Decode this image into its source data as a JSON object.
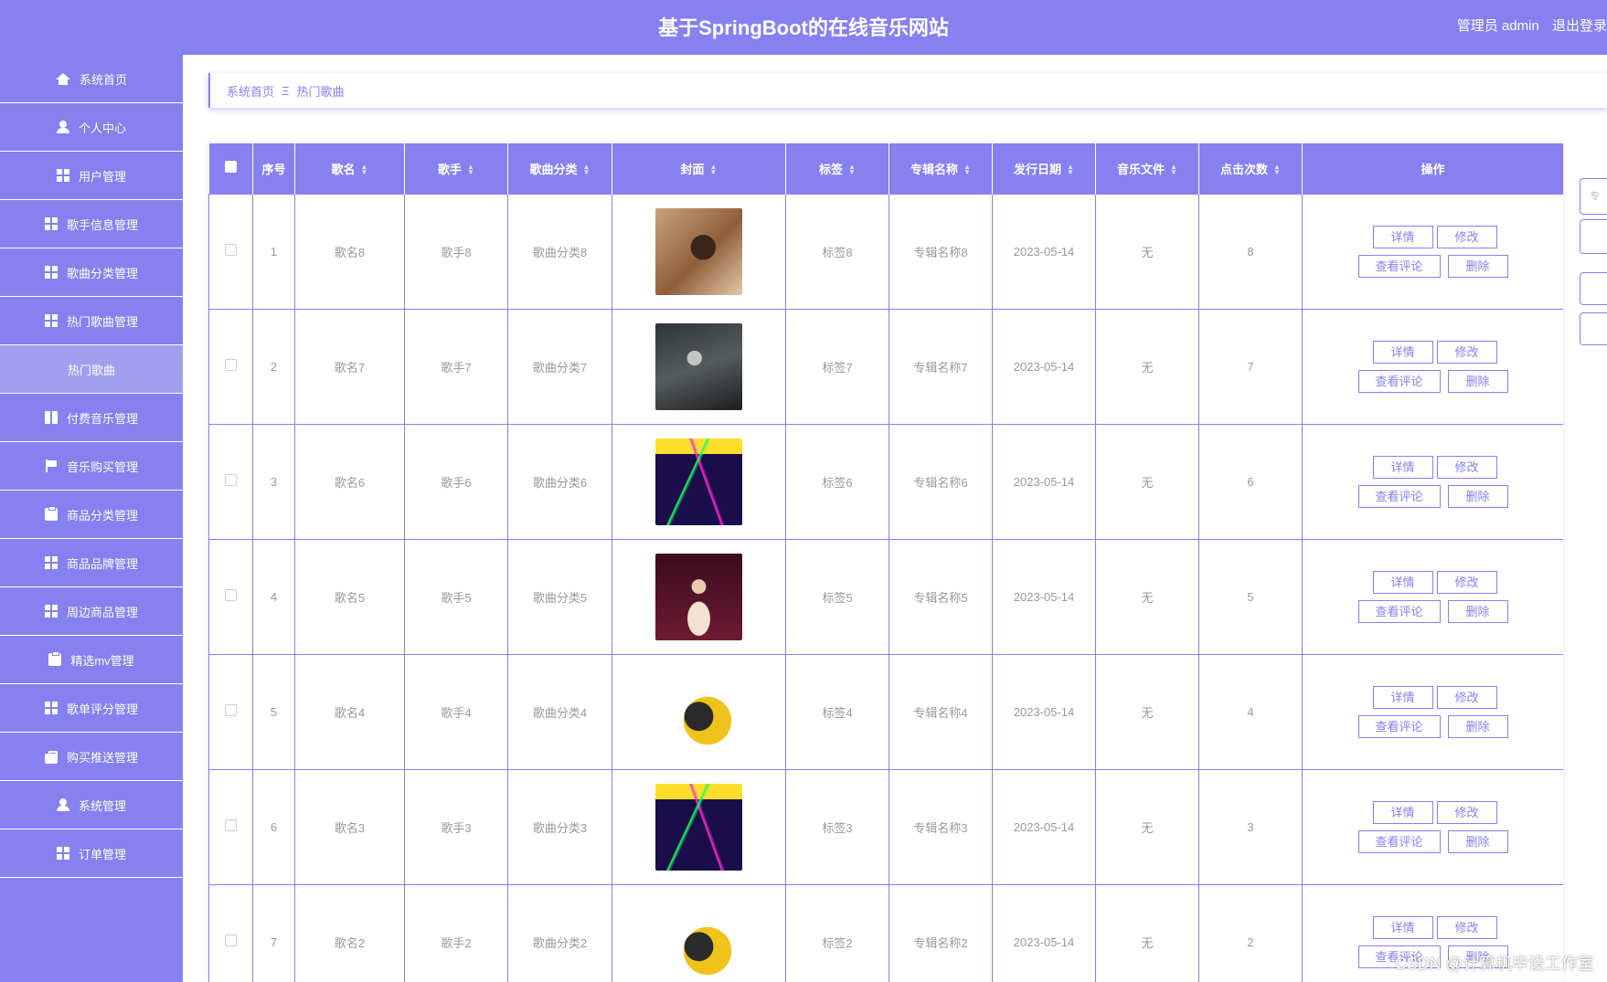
{
  "header": {
    "title": "基于SpringBoot的在线音乐网站",
    "user_label": "管理员 admin",
    "logout": "退出登录"
  },
  "sidebar": {
    "items": [
      {
        "label": "系统首页",
        "icon": "home-icon"
      },
      {
        "label": "个人中心",
        "icon": "user-icon"
      },
      {
        "label": "用户管理",
        "icon": "grid-icon"
      },
      {
        "label": "歌手信息管理",
        "icon": "grid-icon"
      },
      {
        "label": "歌曲分类管理",
        "icon": "grid-icon"
      },
      {
        "label": "热门歌曲管理",
        "icon": "grid-icon"
      },
      {
        "label": "热门歌曲",
        "icon": ""
      },
      {
        "label": "付费音乐管理",
        "icon": "book-icon"
      },
      {
        "label": "音乐购买管理",
        "icon": "flag-icon"
      },
      {
        "label": "商品分类管理",
        "icon": "clipboard-icon"
      },
      {
        "label": "商品品牌管理",
        "icon": "grid-icon"
      },
      {
        "label": "周边商品管理",
        "icon": "grid-icon"
      },
      {
        "label": "精选mv管理",
        "icon": "clipboard-icon"
      },
      {
        "label": "歌单评分管理",
        "icon": "grid-icon"
      },
      {
        "label": "购买推送管理",
        "icon": "briefcase-icon"
      },
      {
        "label": "系统管理",
        "icon": "user-icon"
      },
      {
        "label": "订单管理",
        "icon": "grid-icon"
      }
    ]
  },
  "breadcrumb": {
    "home": "系统首页",
    "separator": "Ξ",
    "current": "热门歌曲"
  },
  "table": {
    "columns": [
      "序号",
      "歌名",
      "歌手",
      "歌曲分类",
      "封面",
      "标签",
      "专辑名称",
      "发行日期",
      "音乐文件",
      "点击次数",
      "操作"
    ],
    "actions": {
      "detail": "详情",
      "edit": "修改",
      "comments": "查看评论",
      "delete": "删除"
    },
    "rows": [
      {
        "index": "1",
        "name": "歌名8",
        "singer": "歌手8",
        "category": "歌曲分类8",
        "cover": "cover-1",
        "tag": "标签8",
        "album": "专辑名称8",
        "date": "2023-05-14",
        "file": "无",
        "clicks": "8"
      },
      {
        "index": "2",
        "name": "歌名7",
        "singer": "歌手7",
        "category": "歌曲分类7",
        "cover": "cover-2",
        "tag": "标签7",
        "album": "专辑名称7",
        "date": "2023-05-14",
        "file": "无",
        "clicks": "7"
      },
      {
        "index": "3",
        "name": "歌名6",
        "singer": "歌手6",
        "category": "歌曲分类6",
        "cover": "cover-3",
        "tag": "标签6",
        "album": "专辑名称6",
        "date": "2023-05-14",
        "file": "无",
        "clicks": "6"
      },
      {
        "index": "4",
        "name": "歌名5",
        "singer": "歌手5",
        "category": "歌曲分类5",
        "cover": "cover-4",
        "tag": "标签5",
        "album": "专辑名称5",
        "date": "2023-05-14",
        "file": "无",
        "clicks": "5"
      },
      {
        "index": "5",
        "name": "歌名4",
        "singer": "歌手4",
        "category": "歌曲分类4",
        "cover": "cover-5",
        "tag": "标签4",
        "album": "专辑名称4",
        "date": "2023-05-14",
        "file": "无",
        "clicks": "4"
      },
      {
        "index": "6",
        "name": "歌名3",
        "singer": "歌手3",
        "category": "歌曲分类3",
        "cover": "cover-3",
        "tag": "标签3",
        "album": "专辑名称3",
        "date": "2023-05-14",
        "file": "无",
        "clicks": "3"
      },
      {
        "index": "7",
        "name": "歌名2",
        "singer": "歌手2",
        "category": "歌曲分类2",
        "cover": "cover-5",
        "tag": "标签2",
        "album": "专辑名称2",
        "date": "2023-05-14",
        "file": "无",
        "clicks": "2"
      }
    ]
  },
  "right_panel": {
    "search_placeholder": "专"
  },
  "watermark": "CSDN @计算机毕设工作室",
  "colors": {
    "primary": "#8680f0",
    "active_menu": "#a29ef0",
    "text_muted": "#999999"
  }
}
